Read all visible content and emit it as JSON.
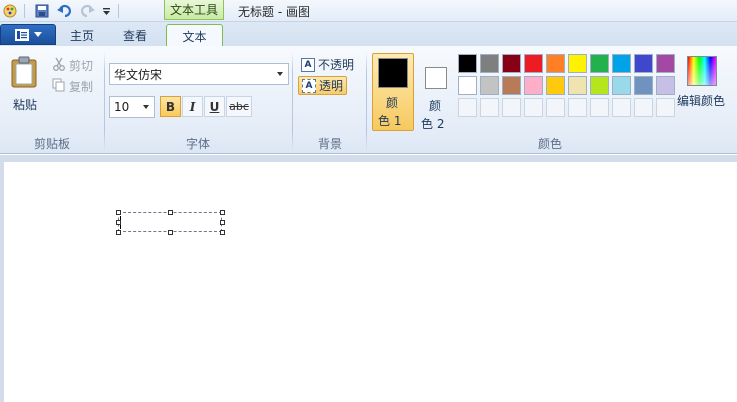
{
  "window": {
    "title": "无标题 - 画图",
    "contextual_tab": "文本工具"
  },
  "tabs": [
    {
      "label": "主页",
      "active": false
    },
    {
      "label": "查看",
      "active": false
    },
    {
      "label": "文本",
      "active": true
    }
  ],
  "clipboard": {
    "paste": "粘贴",
    "cut": "剪切",
    "copy": "复制",
    "group_label": "剪贴板"
  },
  "font": {
    "family": "华文仿宋",
    "size": "10",
    "bold_label": "B",
    "italic_label": "I",
    "underline_label": "U",
    "strike_label": "abc",
    "group_label": "字体",
    "bold_active": true
  },
  "background": {
    "opaque": "不透明",
    "transparent": "透明",
    "icon_letter": "A",
    "group_label": "背景",
    "selected": "transparent"
  },
  "colors": {
    "color1_label": "颜\n色 1",
    "color1_line1": "颜",
    "color1_line2": "色 1",
    "color2_line1": "颜",
    "color2_line2": "色 2",
    "color1": "#000000",
    "color2": "#ffffff",
    "edit": "编辑颜色",
    "group_label": "颜色",
    "palette_row1": [
      "#000000",
      "#7f7f7f",
      "#880015",
      "#ed1c24",
      "#ff7f27",
      "#fff200",
      "#22b14c",
      "#00a2e8",
      "#3f48cc",
      "#a349a4"
    ],
    "palette_row2": [
      "#ffffff",
      "#c3c3c3",
      "#b97a57",
      "#ffaec9",
      "#ffc90e",
      "#efe4b0",
      "#b5e61d",
      "#99d9ea",
      "#7092be",
      "#c8bfe7"
    ],
    "palette_row3_count": 10
  }
}
